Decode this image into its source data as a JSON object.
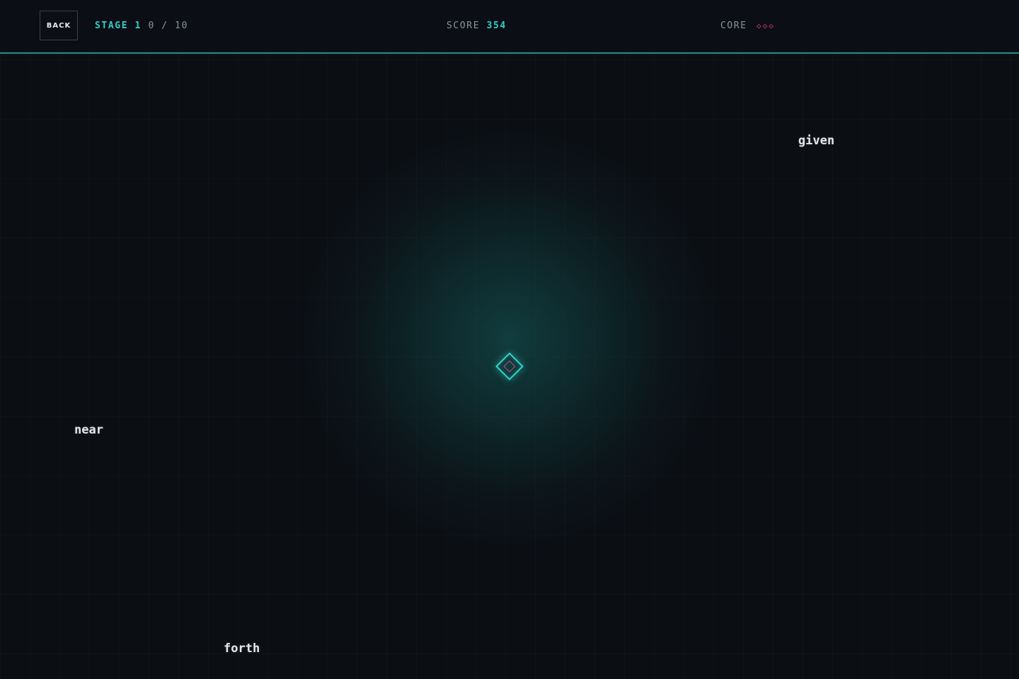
{
  "hud": {
    "back_label": "BACK",
    "stage_label": "STAGE 1",
    "stage_progress": "0 / 10",
    "score_label": "SCORE",
    "score_value": "354",
    "core_label": "CORE",
    "core_lives_display": "◇◇◇",
    "core_lives": 3
  },
  "words": {
    "given": "given",
    "near": "near",
    "forth": "forth"
  },
  "colors": {
    "accent": "#2fd1c6",
    "background": "#0b0e13",
    "danger": "#d8465e",
    "core_inner": "#c6508c"
  }
}
